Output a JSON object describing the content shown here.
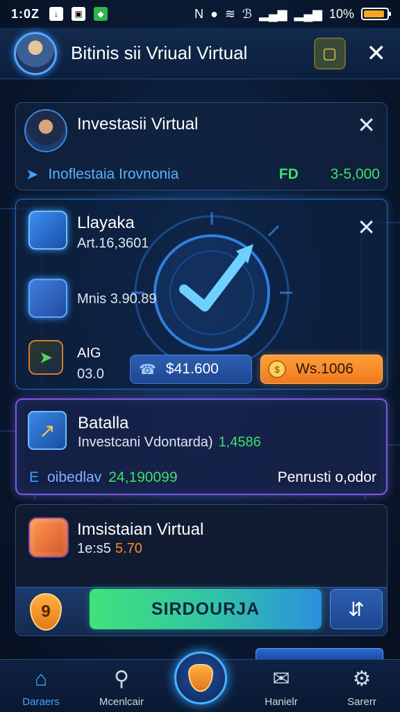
{
  "status_bar": {
    "time": "1:0Z",
    "battery_percent": "10%",
    "battery_level": 0.9,
    "icons": [
      "download-icon",
      "gallery-icon",
      "shield-app-icon",
      "nfc-icon",
      "dnd-icon",
      "wifi-icon",
      "bluetooth-icon",
      "signal-icon",
      "signal-icon",
      "battery-icon"
    ]
  },
  "header": {
    "title": "Bitinis sii Vriual Virtual",
    "action_icon": "notes-icon",
    "close_icon": "close-icon"
  },
  "card1": {
    "title": "Investasii Virtual",
    "row_label": "Inoflestaia Irovnonia",
    "row_code": "FD",
    "row_amount": "3-5,000"
  },
  "card2": {
    "title": "Llayaka",
    "subtitle": "Art.16,3601",
    "row2": "Mnis 3.90.89",
    "ai_label": "AIG",
    "ai_value": "03.0",
    "pill_blue_label": "$41.600",
    "pill_orange_label": "Ws.1006"
  },
  "card3": {
    "title": "Batalla",
    "subtitle": "Investcani Vdontarda)",
    "subtitle_value": "1,4586",
    "row_prefix": "E",
    "row_label": "oibedlav",
    "row_value": "24,190099",
    "row_right": "Penrusti o,odor"
  },
  "card4": {
    "title": "Imsistaian Virtual",
    "subtitle_prefix": "1e:s5",
    "subtitle_value": "5.70",
    "shield_label": "9",
    "cta_label": "SIRDOURJA"
  },
  "bottom_nav": {
    "items": [
      {
        "label": "Daraers",
        "icon": "home-icon"
      },
      {
        "label": "Mcenlcair",
        "icon": "search-icon"
      },
      {
        "label": "",
        "icon": "shield-icon"
      },
      {
        "label": "Hanielr",
        "icon": "mail-icon"
      },
      {
        "label": "Sarerr",
        "icon": "gear-icon"
      }
    ]
  },
  "colors": {
    "accent_blue": "#3fa8ff",
    "positive_green": "#3ee06a",
    "warning_orange": "#f07a1e",
    "background": "#0a1a33"
  }
}
